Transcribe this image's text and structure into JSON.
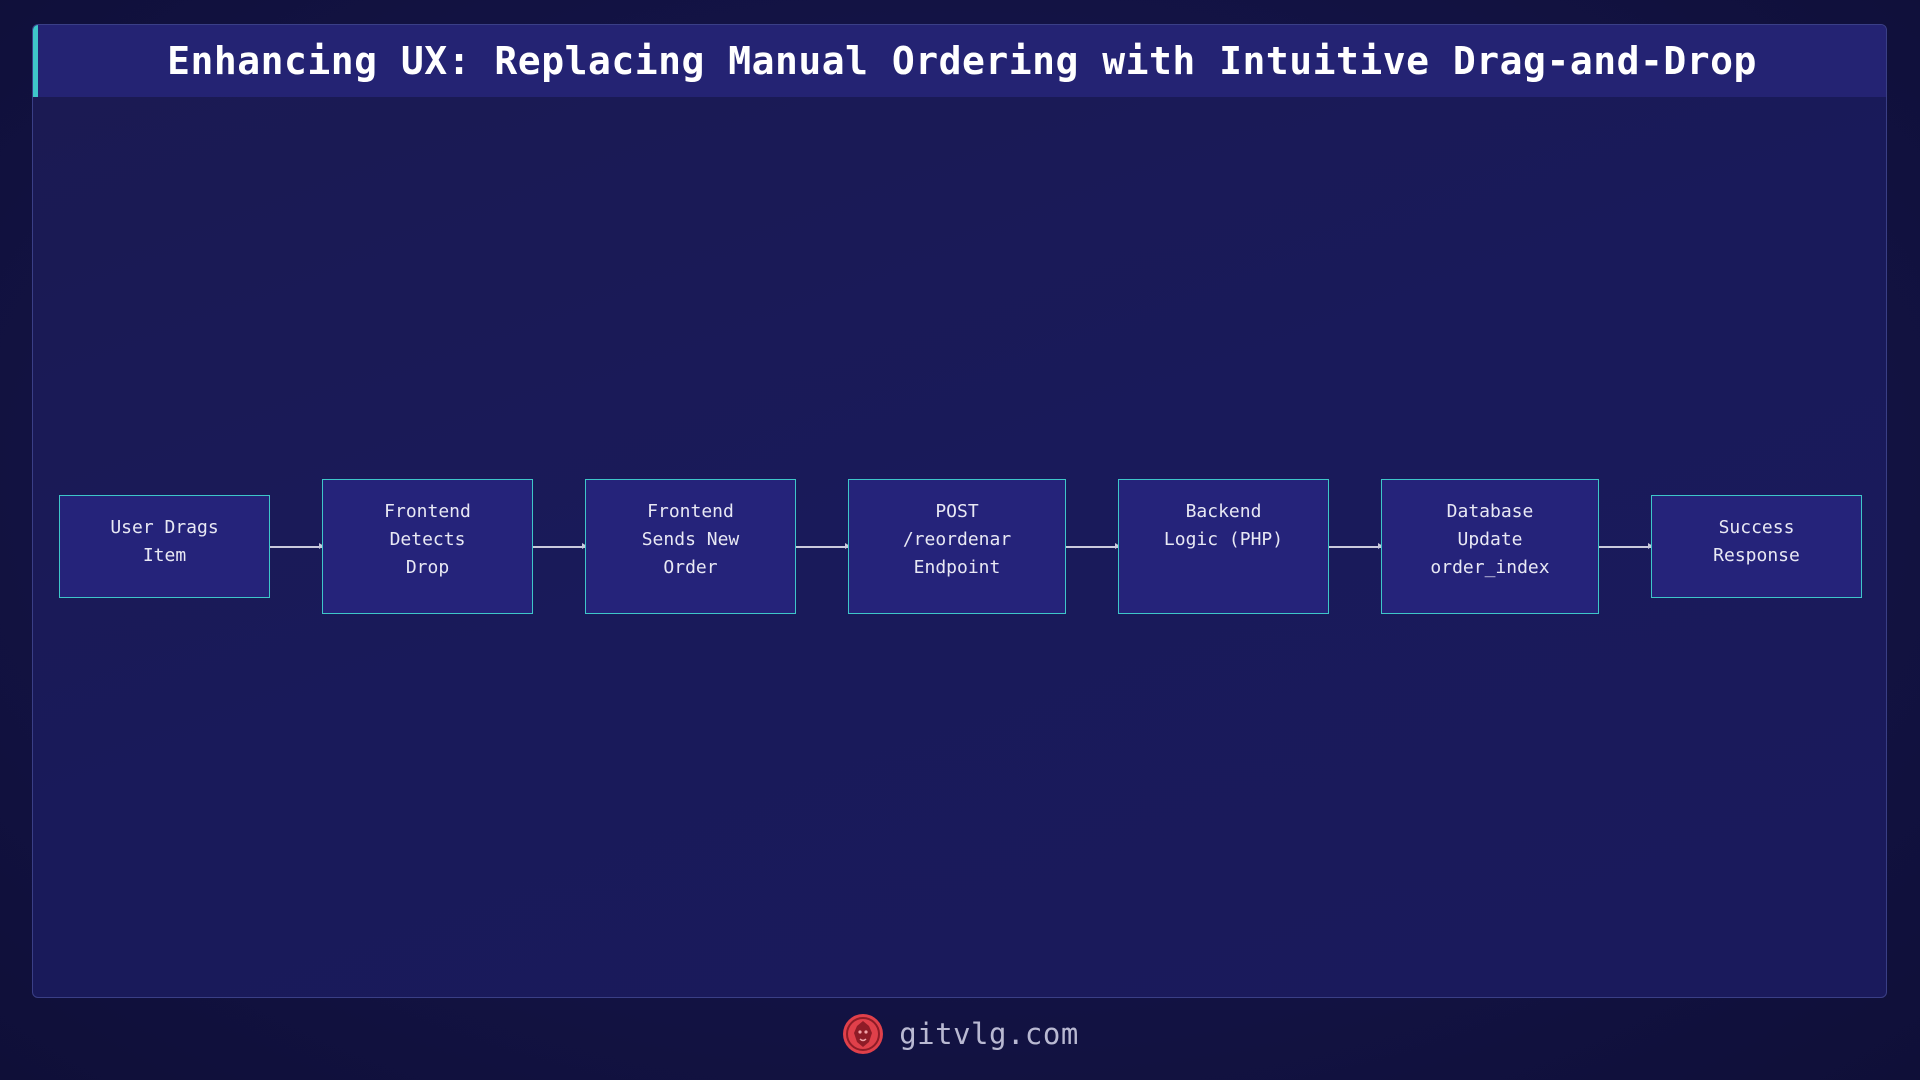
{
  "title": "Enhancing UX: Replacing Manual Ordering with Intuitive Drag-and-Drop",
  "nodes": [
    {
      "label": "User Drags\nItem"
    },
    {
      "label": "Frontend\nDetects\nDrop"
    },
    {
      "label": "Frontend\nSends New\nOrder"
    },
    {
      "label": "POST\n/reordenar\nEndpoint"
    },
    {
      "label": "Backend\nLogic (PHP)"
    },
    {
      "label": "Database\nUpdate\norder_index"
    },
    {
      "label": "Success\nResponse"
    }
  ],
  "edges": [
    {
      "from": 0,
      "to": 1
    },
    {
      "from": 1,
      "to": 2
    },
    {
      "from": 2,
      "to": 3
    },
    {
      "from": 3,
      "to": 4
    },
    {
      "from": 4,
      "to": 5
    },
    {
      "from": 5,
      "to": 6
    }
  ],
  "footer": {
    "site": "gitvlg.com",
    "logo_icon": "lion-logo-icon"
  },
  "colors": {
    "accent": "#3ec6c9",
    "node_fill": "#25237a",
    "header_fill": "#242373",
    "logo": "#e0404a"
  }
}
